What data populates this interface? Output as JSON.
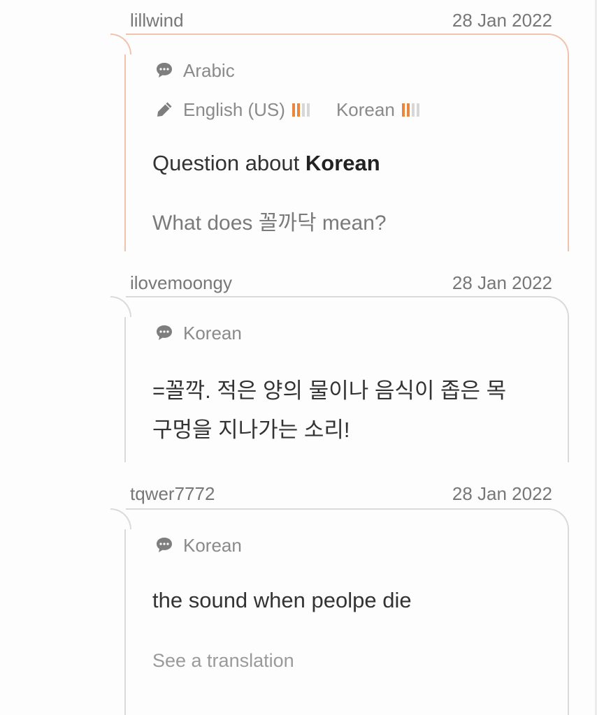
{
  "posts": [
    {
      "username": "lillwind",
      "date": "28 Jan 2022",
      "type": "question",
      "native_language": "Arabic",
      "studying": [
        {
          "language": "English (US)",
          "level_of_4": 2
        },
        {
          "language": "Korean",
          "level_of_4": 2
        }
      ],
      "question_prefix": "Question about ",
      "question_language": "Korean",
      "question_text": "What does 꼴까닥 mean?"
    },
    {
      "username": "ilovemoongy",
      "date": "28 Jan 2022",
      "type": "answer",
      "native_language": "Korean",
      "answer_lines": [
        "=꼴깍. 적은 양의 물이나 음식이 좁은 목",
        "구멍을 지나가는 소리!"
      ]
    },
    {
      "username": "tqwer7772",
      "date": "28 Jan 2022",
      "type": "answer",
      "native_language": "Korean",
      "answer_lines": [
        "the sound when peolpe die"
      ],
      "translation_link": "See a translation"
    }
  ],
  "colors": {
    "question_border": "#f0c3ad",
    "answer_border": "#dadada",
    "level_on": "#e8883f",
    "level_off": "#d7d7d7"
  },
  "icons": [
    "speech-bubble-icon",
    "pencil-icon"
  ]
}
